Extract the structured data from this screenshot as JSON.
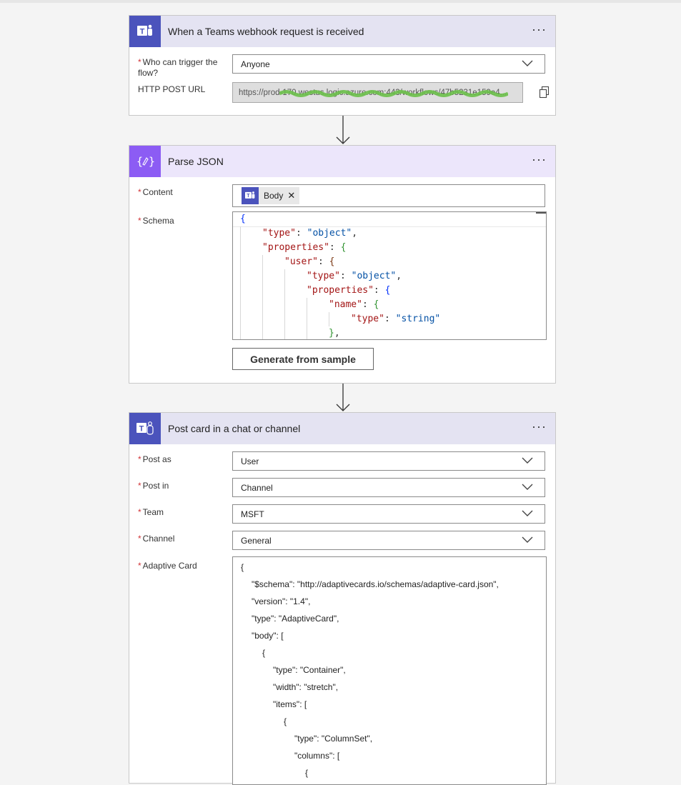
{
  "trigger_card": {
    "title": "When a Teams webhook request is received",
    "who_label": "Who can trigger the flow?",
    "who_value": "Anyone",
    "url_label": "HTTP POST URL",
    "url_value": "https://prod-170.westus.logic.azure.com:443/workflows/47b5231e159e4..."
  },
  "parse_card": {
    "title": "Parse JSON",
    "content_label": "Content",
    "content_token": "Body",
    "schema_label": "Schema",
    "schema_lines": [
      "{",
      "\"type\"",
      "\"object\"",
      "\"properties\"",
      "\"user\"",
      "\"type\"",
      "\"object\"",
      "\"properties\"",
      "\"name\"",
      "\"type\"",
      "\"string\""
    ],
    "generate_button": "Generate from sample"
  },
  "post_card": {
    "title": "Post card in a chat or channel",
    "fields": [
      {
        "label": "Post as",
        "value": "User"
      },
      {
        "label": "Post in",
        "value": "Channel"
      },
      {
        "label": "Team",
        "value": "MSFT"
      },
      {
        "label": "Channel",
        "value": "General"
      }
    ],
    "adaptive_label": "Adaptive Card",
    "adaptive_lines": [
      "{",
      "\"$schema\": \"http://adaptivecards.io/schemas/adaptive-card.json\",",
      "\"version\": \"1.4\",",
      "\"type\": \"AdaptiveCard\",",
      "\"body\": [",
      "{",
      "\"type\": \"Container\",",
      "\"width\": \"stretch\",",
      "\"items\": [",
      "{",
      "\"type\": \"ColumnSet\",",
      "\"columns\": [",
      "{"
    ]
  },
  "icons": {
    "teams": "teams-logo-icon",
    "parse_json": "parse-json-icon",
    "more": "more-options-icon",
    "chevron": "chevron-down-icon",
    "copy": "copy-icon",
    "remove": "close-icon"
  },
  "colors": {
    "teams_brand": "#4b53bc",
    "json_brand": "#8c5cf4",
    "required": "#d13438"
  }
}
